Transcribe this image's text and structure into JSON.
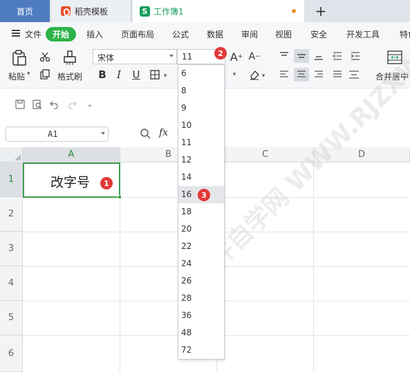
{
  "tabs": {
    "home": "首页",
    "daoke": "稻壳模板",
    "workbook_logo": "S",
    "workbook": "工作簿1",
    "add": "+"
  },
  "menu": {
    "file": "文件",
    "items": [
      "开始",
      "插入",
      "页面布局",
      "公式",
      "数据",
      "审阅",
      "视图",
      "安全",
      "开发工具",
      "特色"
    ]
  },
  "ribbon": {
    "paste": "粘贴",
    "format_painter": "格式刷",
    "font_name": "宋体",
    "font_size": "11",
    "bold": "B",
    "italic": "I",
    "underline": "U",
    "grow_font": "A",
    "shrink_font": "A",
    "merge_center": "合并居中"
  },
  "formula_bar": {
    "cell_ref": "A1",
    "fx": "fx"
  },
  "grid": {
    "columns": [
      "A",
      "B",
      "C",
      "D"
    ],
    "rows": [
      "1",
      "2",
      "3",
      "4",
      "5",
      "6"
    ],
    "cell_a1": "改字号"
  },
  "font_size_dropdown": {
    "options": [
      "6",
      "8",
      "9",
      "10",
      "11",
      "12",
      "14",
      "16",
      "18",
      "20",
      "22",
      "24",
      "26",
      "28",
      "36",
      "48",
      "72"
    ],
    "highlighted": "16"
  },
  "badges": [
    "1",
    "2",
    "3"
  ],
  "watermark": "软件自学网 WWW.RJZXW.COM",
  "colors": {
    "home_tab": "#4f7cc0",
    "active_menu": "#2db34a",
    "selection": "#3b9d4c",
    "badge": "#e23838"
  }
}
